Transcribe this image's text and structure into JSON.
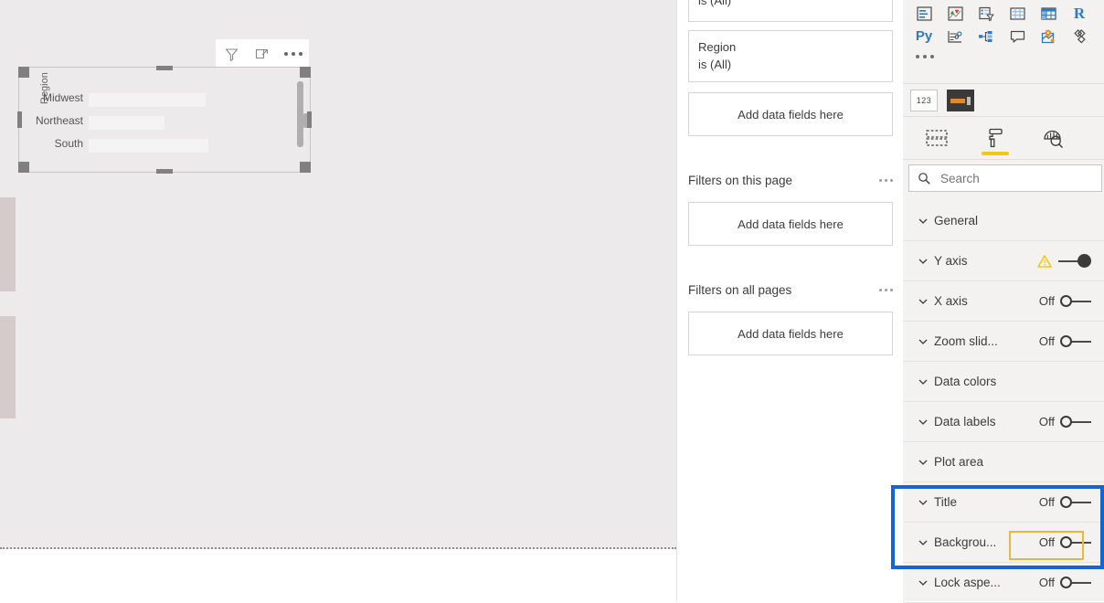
{
  "app": "Power BI Desktop report editor",
  "canvas": {
    "visual_header": {
      "filter_icon": "filter-icon",
      "focus_icon": "focus-mode-icon",
      "more_icon": "more-options-icon"
    },
    "visual": {
      "type": "bar",
      "axis_title": "Region",
      "selected": true,
      "scrollbar": true
    }
  },
  "chart_data": {
    "type": "bar",
    "orientation": "horizontal",
    "title": "",
    "xlabel": "",
    "ylabel": "Region",
    "categories": [
      "Midwest",
      "Northeast",
      "South"
    ],
    "values": [
      128,
      83,
      131
    ],
    "xlim": [
      0,
      180
    ],
    "grid": false,
    "legend": "none",
    "axis_labels_visible": false,
    "bar_color": "#f4f3f3",
    "label_color": "#555555"
  },
  "filter_pane": {
    "top_card": {
      "line1": "is (All)"
    },
    "region_card": {
      "field": "Region",
      "condition": "is (All)"
    },
    "visual_drop": "Add data fields here",
    "sections": [
      {
        "title": "Filters on this page",
        "drop": "Add data fields here",
        "menu": "more-options-icon"
      },
      {
        "title": "Filters on all pages",
        "drop": "Add data fields here",
        "menu": "more-options-icon"
      }
    ]
  },
  "viz_pane": {
    "gallery_row1": [
      {
        "name": "multi-row-card-icon",
        "label": "Multi-row card"
      },
      {
        "name": "kpi-icon",
        "label": "KPI"
      },
      {
        "name": "slicer-icon",
        "label": "Slicer"
      },
      {
        "name": "table-icon",
        "label": "Table"
      },
      {
        "name": "matrix-icon",
        "label": "Matrix"
      },
      {
        "name": "r-script-visual-icon",
        "label": "R"
      }
    ],
    "gallery_row2": [
      {
        "name": "python-visual-icon",
        "label": "Py"
      },
      {
        "name": "key-influencers-icon",
        "label": "Key influencers"
      },
      {
        "name": "decomposition-tree-icon",
        "label": "Decomposition tree"
      },
      {
        "name": "smart-narrative-icon",
        "label": "Smart narrative"
      },
      {
        "name": "arcgis-maps-icon",
        "label": "ArcGIS Maps"
      },
      {
        "name": "power-apps-icon",
        "label": "Power Apps"
      }
    ],
    "gallery_more": "more-visuals-icon",
    "template_row": [
      {
        "name": "card-template-icon",
        "label": "123"
      },
      {
        "name": "custom-visual-icon",
        "label": ""
      }
    ],
    "tabs": [
      {
        "name": "fields-tab",
        "icon": "fields-icon",
        "label": "Fields",
        "selected": false
      },
      {
        "name": "format-tab",
        "icon": "paint-roller-icon",
        "label": "Format",
        "selected": true
      },
      {
        "name": "analytics-tab",
        "icon": "analytics-magnifier-icon",
        "label": "Analytics",
        "selected": false
      }
    ],
    "search": {
      "placeholder": "Search",
      "value": "",
      "icon": "search-icon"
    },
    "format_options": [
      {
        "label": "General",
        "toggle": "none",
        "state": "",
        "warning": false
      },
      {
        "label": "Y axis",
        "toggle": "on",
        "state": "",
        "warning": true
      },
      {
        "label": "X axis",
        "toggle": "off",
        "state": "Off",
        "warning": false
      },
      {
        "label": "Zoom slid...",
        "toggle": "off",
        "state": "Off",
        "warning": false
      },
      {
        "label": "Data colors",
        "toggle": "none",
        "state": "",
        "warning": false
      },
      {
        "label": "Data labels",
        "toggle": "off",
        "state": "Off",
        "warning": false
      },
      {
        "label": "Plot area",
        "toggle": "none",
        "state": "",
        "warning": false
      },
      {
        "label": "Title",
        "toggle": "off",
        "state": "Off",
        "warning": false
      },
      {
        "label": "Backgrou...",
        "toggle": "off",
        "state": "Off",
        "warning": false
      },
      {
        "label": "Lock aspe...",
        "toggle": "off",
        "state": "Off",
        "warning": false
      }
    ],
    "highlight": {
      "color": "#1266d4",
      "covers": [
        "Title",
        "Backgrou..."
      ]
    },
    "focus_ring": {
      "color": "#e8b838",
      "target": "background-toggle"
    }
  },
  "colors": {
    "canvas_bg": "#eceaea",
    "pane_bg": "#f3f2f1",
    "accent_yellow": "#f2c811",
    "highlight_blue": "#1266d4",
    "focus_yellow": "#e8b838"
  }
}
